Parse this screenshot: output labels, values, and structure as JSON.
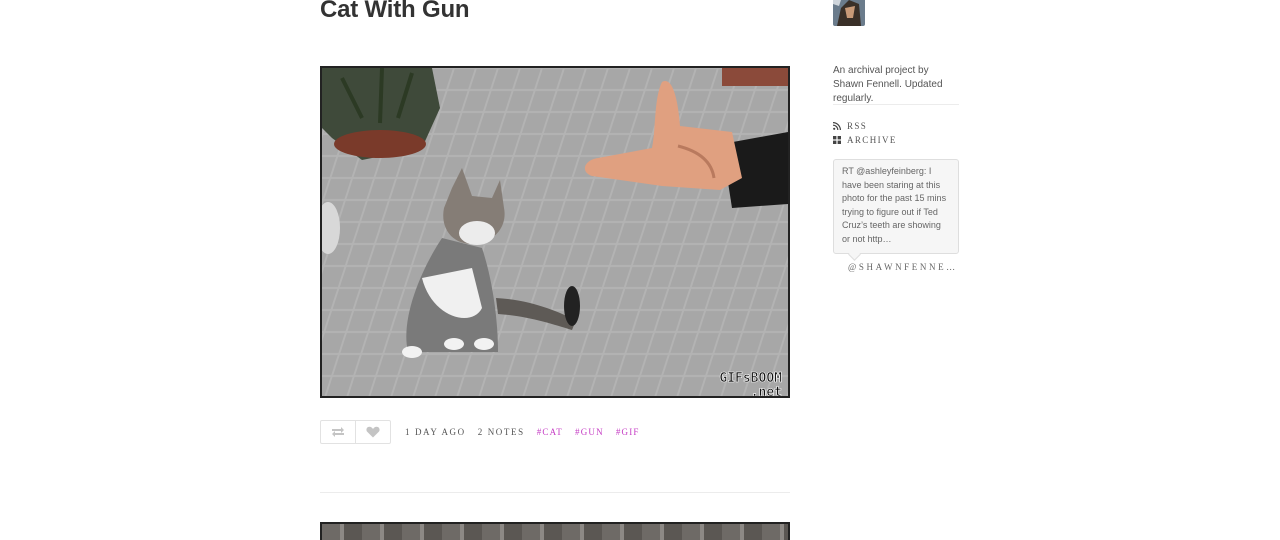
{
  "post": {
    "title": "Cat With Gun",
    "photo_watermark": "GIFsBOOM\n.net",
    "footer": {
      "reblog_icon": "reblog-icon",
      "like_icon": "heart-icon",
      "time": "1 DAY AGO",
      "notes": "2 NOTES",
      "tags": [
        "CAT",
        "GUN",
        "GIF"
      ]
    }
  },
  "sidebar": {
    "description": "An archival project by Shawn Fennell. Updated regularly.",
    "links": [
      {
        "label": "RSS",
        "icon": "rss-icon"
      },
      {
        "label": "ARCHIVE",
        "icon": "grid-icon"
      }
    ],
    "tweet": {
      "text": "RT @ashleyfeinberg: I have been staring at this photo for the past 15 mins trying to figure out if Ted Cruz’s teeth are showing or not http…",
      "handle": "@SHAWNFENNELL"
    }
  },
  "colors": {
    "tag": "#c53cc4",
    "text": "#333333",
    "muted": "#555555"
  }
}
